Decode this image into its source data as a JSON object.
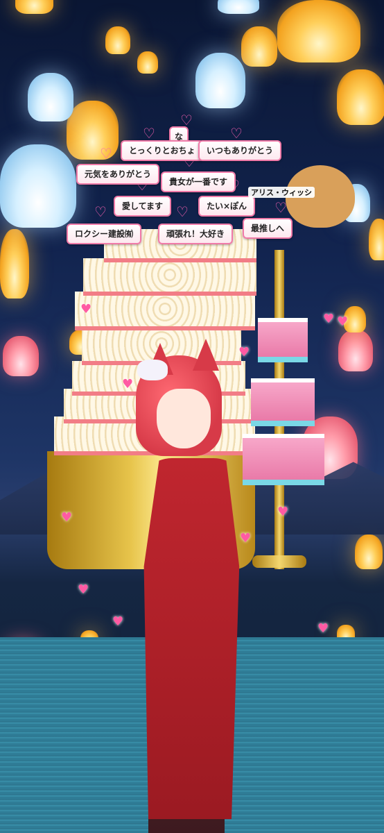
{
  "messages": {
    "m_na": "な",
    "m_tokkuri": "とっくりとおちょ",
    "m_itsumo": "いつもありがとう",
    "m_genki": "元気をありがとう",
    "m_kijo": "貴女が一番です",
    "m_aishite": "愛してます",
    "m_tai": "たい×ぽん",
    "m_rokushi": "ロクシー建設㈲",
    "m_ganbare": "頑張れ！大好き",
    "m_saioshi": "最推しへ"
  },
  "tags": {
    "alice": "アリス・ウィッシ"
  },
  "colors": {
    "sky": "#0f1d40",
    "accent_pink": "#f07aa8",
    "dress_red": "#c0262f"
  }
}
